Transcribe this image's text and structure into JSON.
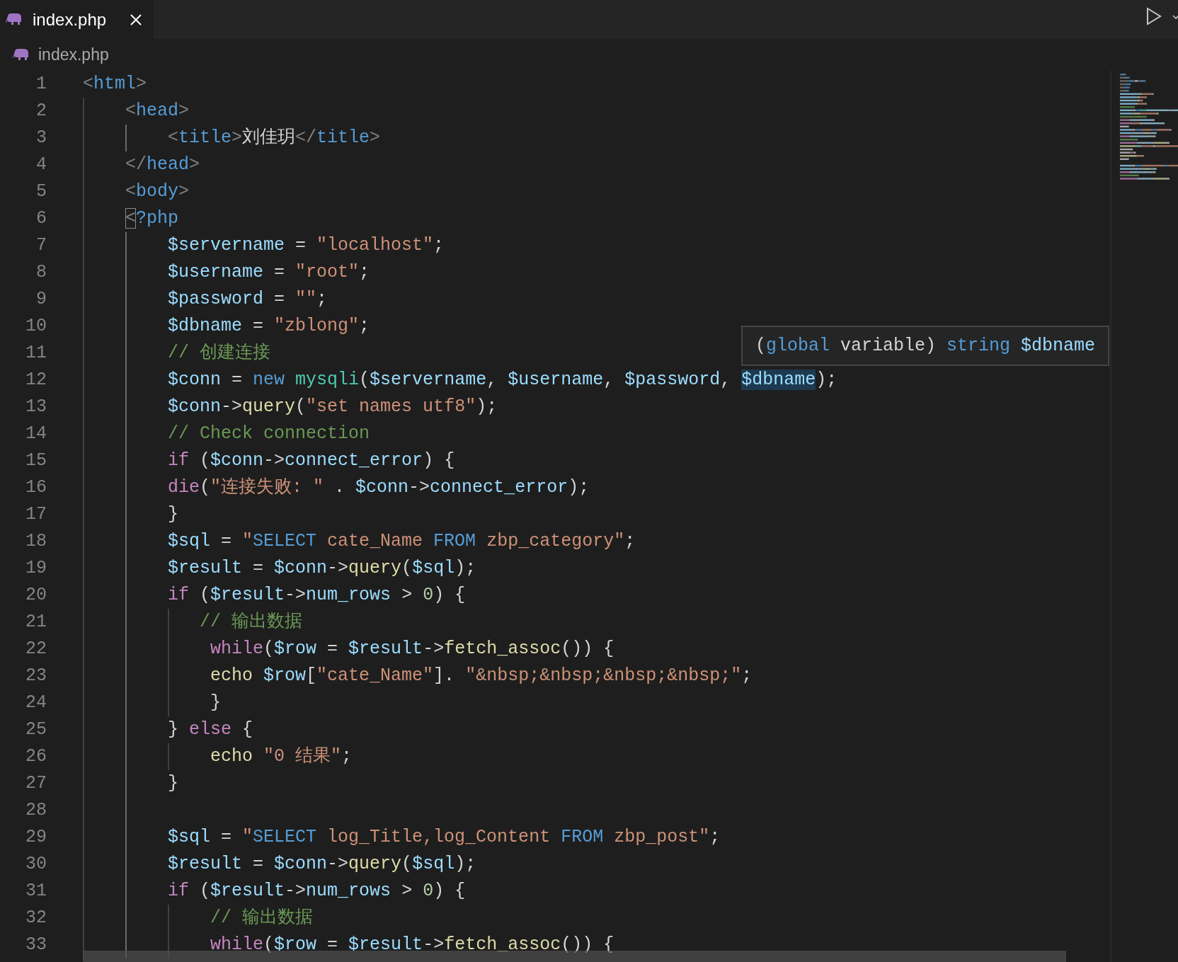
{
  "tabs": [
    {
      "label": "index.php",
      "selected": true
    }
  ],
  "breadcrumb": {
    "label": "index.php"
  },
  "lines": [
    {
      "number": "1",
      "tokens": [
        {
          "text": "<",
          "kind": "bracket"
        },
        {
          "text": "html",
          "kind": "tag"
        },
        {
          "text": ">",
          "kind": "bracket"
        }
      ]
    },
    {
      "number": "2",
      "tokens": [
        {
          "text": "    <",
          "kind": "bracket"
        },
        {
          "text": "head",
          "kind": "tag"
        },
        {
          "text": ">",
          "kind": "bracket"
        }
      ]
    },
    {
      "number": "3",
      "tokens": [
        {
          "text": "        <",
          "kind": "bracket"
        },
        {
          "text": "title",
          "kind": "tag"
        },
        {
          "text": ">",
          "kind": "bracket"
        },
        {
          "text": "刘佳玥",
          "kind": "plain"
        },
        {
          "text": "</",
          "kind": "bracket"
        },
        {
          "text": "title",
          "kind": "tag"
        },
        {
          "text": ">",
          "kind": "bracket"
        }
      ]
    },
    {
      "number": "4",
      "tokens": [
        {
          "text": "    </",
          "kind": "bracket"
        },
        {
          "text": "head",
          "kind": "tag"
        },
        {
          "text": ">",
          "kind": "bracket"
        }
      ]
    },
    {
      "number": "5",
      "tokens": [
        {
          "text": "    <",
          "kind": "bracket"
        },
        {
          "text": "body",
          "kind": "tag"
        },
        {
          "text": ">",
          "kind": "bracket"
        }
      ]
    },
    {
      "number": "6",
      "tokens": [
        {
          "text": "    <",
          "kind": "bracket",
          "matched": true
        },
        {
          "text": "?php",
          "kind": "tag"
        }
      ]
    },
    {
      "number": "7",
      "tokens": [
        {
          "text": "        $servername",
          "kind": "variable"
        },
        {
          "text": " = ",
          "kind": "plain"
        },
        {
          "text": "\"localhost\"",
          "kind": "string"
        },
        {
          "text": ";",
          "kind": "plain"
        }
      ]
    },
    {
      "number": "8",
      "tokens": [
        {
          "text": "        $username",
          "kind": "variable"
        },
        {
          "text": " = ",
          "kind": "plain"
        },
        {
          "text": "\"root\"",
          "kind": "string"
        },
        {
          "text": ";",
          "kind": "plain"
        }
      ]
    },
    {
      "number": "9",
      "tokens": [
        {
          "text": "        $password",
          "kind": "variable"
        },
        {
          "text": " = ",
          "kind": "plain"
        },
        {
          "text": "\"\"",
          "kind": "string"
        },
        {
          "text": ";",
          "kind": "plain"
        }
      ]
    },
    {
      "number": "10",
      "tokens": [
        {
          "text": "        $dbname",
          "kind": "variable"
        },
        {
          "text": " = ",
          "kind": "plain"
        },
        {
          "text": "\"zblong\"",
          "kind": "string"
        },
        {
          "text": ";",
          "kind": "plain"
        }
      ]
    },
    {
      "number": "11",
      "tokens": [
        {
          "text": "        // 创建连接",
          "kind": "comment"
        }
      ]
    },
    {
      "number": "12",
      "tokens": [
        {
          "text": "        $conn",
          "kind": "variable"
        },
        {
          "text": " = ",
          "kind": "plain"
        },
        {
          "text": "new ",
          "kind": "keyword"
        },
        {
          "text": "mysqli",
          "kind": "class"
        },
        {
          "text": "(",
          "kind": "plain"
        },
        {
          "text": "$servername",
          "kind": "variable"
        },
        {
          "text": ", ",
          "kind": "plain"
        },
        {
          "text": "$username",
          "kind": "variable"
        },
        {
          "text": ", ",
          "kind": "plain"
        },
        {
          "text": "$password",
          "kind": "variable"
        },
        {
          "text": ", ",
          "kind": "plain"
        },
        {
          "text": "$dbname",
          "kind": "variable",
          "highlighted": true
        },
        {
          "text": ");",
          "kind": "plain"
        }
      ]
    },
    {
      "number": "13",
      "tokens": [
        {
          "text": "        $conn",
          "kind": "variable"
        },
        {
          "text": "->",
          "kind": "plain"
        },
        {
          "text": "query",
          "kind": "function"
        },
        {
          "text": "(",
          "kind": "plain"
        },
        {
          "text": "\"set names utf8\"",
          "kind": "string"
        },
        {
          "text": ");",
          "kind": "plain"
        }
      ]
    },
    {
      "number": "14",
      "tokens": [
        {
          "text": "        // Check connection",
          "kind": "comment"
        }
      ]
    },
    {
      "number": "15",
      "tokens": [
        {
          "text": "        if",
          "kind": "control"
        },
        {
          "text": " (",
          "kind": "plain"
        },
        {
          "text": "$conn",
          "kind": "variable"
        },
        {
          "text": "->",
          "kind": "plain"
        },
        {
          "text": "connect_error",
          "kind": "variable"
        },
        {
          "text": ") {",
          "kind": "plain"
        }
      ]
    },
    {
      "number": "16",
      "tokens": [
        {
          "text": "        die",
          "kind": "control"
        },
        {
          "text": "(",
          "kind": "plain"
        },
        {
          "text": "\"连接失败: \"",
          "kind": "string"
        },
        {
          "text": " . ",
          "kind": "plain"
        },
        {
          "text": "$conn",
          "kind": "variable"
        },
        {
          "text": "->",
          "kind": "plain"
        },
        {
          "text": "connect_error",
          "kind": "variable"
        },
        {
          "text": ");",
          "kind": "plain"
        }
      ]
    },
    {
      "number": "17",
      "tokens": [
        {
          "text": "        }",
          "kind": "plain"
        }
      ]
    },
    {
      "number": "18",
      "tokens": [
        {
          "text": "        $sql",
          "kind": "variable"
        },
        {
          "text": " = ",
          "kind": "plain"
        },
        {
          "text": "\"",
          "kind": "string"
        },
        {
          "text": "SELECT",
          "kind": "keyword"
        },
        {
          "text": " cate_Name ",
          "kind": "string"
        },
        {
          "text": "FROM",
          "kind": "keyword"
        },
        {
          "text": " zbp_category\"",
          "kind": "string"
        },
        {
          "text": ";",
          "kind": "plain"
        }
      ]
    },
    {
      "number": "19",
      "tokens": [
        {
          "text": "        $result",
          "kind": "variable"
        },
        {
          "text": " = ",
          "kind": "plain"
        },
        {
          "text": "$conn",
          "kind": "variable"
        },
        {
          "text": "->",
          "kind": "plain"
        },
        {
          "text": "query",
          "kind": "function"
        },
        {
          "text": "(",
          "kind": "plain"
        },
        {
          "text": "$sql",
          "kind": "variable"
        },
        {
          "text": ");",
          "kind": "plain"
        }
      ]
    },
    {
      "number": "20",
      "tokens": [
        {
          "text": "        if",
          "kind": "control"
        },
        {
          "text": " (",
          "kind": "plain"
        },
        {
          "text": "$result",
          "kind": "variable"
        },
        {
          "text": "->",
          "kind": "plain"
        },
        {
          "text": "num_rows",
          "kind": "variable"
        },
        {
          "text": " > ",
          "kind": "plain"
        },
        {
          "text": "0",
          "kind": "number"
        },
        {
          "text": ") {",
          "kind": "plain"
        }
      ]
    },
    {
      "number": "21",
      "tokens": [
        {
          "text": "           // 输出数据",
          "kind": "comment"
        }
      ]
    },
    {
      "number": "22",
      "tokens": [
        {
          "text": "            while",
          "kind": "control"
        },
        {
          "text": "(",
          "kind": "plain"
        },
        {
          "text": "$row",
          "kind": "variable"
        },
        {
          "text": " = ",
          "kind": "plain"
        },
        {
          "text": "$result",
          "kind": "variable"
        },
        {
          "text": "->",
          "kind": "plain"
        },
        {
          "text": "fetch_assoc",
          "kind": "function"
        },
        {
          "text": "()) {",
          "kind": "plain"
        }
      ]
    },
    {
      "number": "23",
      "tokens": [
        {
          "text": "            echo ",
          "kind": "function"
        },
        {
          "text": "$row",
          "kind": "variable"
        },
        {
          "text": "[",
          "kind": "plain"
        },
        {
          "text": "\"cate_Name\"",
          "kind": "string"
        },
        {
          "text": "]. ",
          "kind": "plain"
        },
        {
          "text": "\"&nbsp;&nbsp;&nbsp;&nbsp;\"",
          "kind": "string"
        },
        {
          "text": ";",
          "kind": "plain"
        }
      ]
    },
    {
      "number": "24",
      "tokens": [
        {
          "text": "            }",
          "kind": "plain"
        }
      ]
    },
    {
      "number": "25",
      "tokens": [
        {
          "text": "        } ",
          "kind": "plain"
        },
        {
          "text": "else",
          "kind": "control"
        },
        {
          "text": " {",
          "kind": "plain"
        }
      ]
    },
    {
      "number": "26",
      "tokens": [
        {
          "text": "            echo ",
          "kind": "function"
        },
        {
          "text": "\"0 结果\"",
          "kind": "string"
        },
        {
          "text": ";",
          "kind": "plain"
        }
      ]
    },
    {
      "number": "27",
      "tokens": [
        {
          "text": "        }",
          "kind": "plain"
        }
      ]
    },
    {
      "number": "28"
    },
    {
      "number": "29",
      "tokens": [
        {
          "text": "        $sql",
          "kind": "variable"
        },
        {
          "text": " = ",
          "kind": "plain"
        },
        {
          "text": "\"",
          "kind": "string"
        },
        {
          "text": "SELECT",
          "kind": "keyword"
        },
        {
          "text": " log_Title,log_Content ",
          "kind": "string"
        },
        {
          "text": "FROM",
          "kind": "keyword"
        },
        {
          "text": " zbp_post\"",
          "kind": "string"
        },
        {
          "text": ";",
          "kind": "plain"
        }
      ]
    },
    {
      "number": "30",
      "tokens": [
        {
          "text": "        $result",
          "kind": "variable"
        },
        {
          "text": " = ",
          "kind": "plain"
        },
        {
          "text": "$conn",
          "kind": "variable"
        },
        {
          "text": "->",
          "kind": "plain"
        },
        {
          "text": "query",
          "kind": "function"
        },
        {
          "text": "(",
          "kind": "plain"
        },
        {
          "text": "$sql",
          "kind": "variable"
        },
        {
          "text": ");",
          "kind": "plain"
        }
      ]
    },
    {
      "number": "31",
      "tokens": [
        {
          "text": "        if",
          "kind": "control"
        },
        {
          "text": " (",
          "kind": "plain"
        },
        {
          "text": "$result",
          "kind": "variable"
        },
        {
          "text": "->",
          "kind": "plain"
        },
        {
          "text": "num_rows",
          "kind": "variable"
        },
        {
          "text": " > ",
          "kind": "plain"
        },
        {
          "text": "0",
          "kind": "number"
        },
        {
          "text": ") {",
          "kind": "plain"
        }
      ]
    },
    {
      "number": "32",
      "tokens": [
        {
          "text": "            // 输出数据",
          "kind": "comment"
        }
      ]
    },
    {
      "number": "33",
      "tokens": [
        {
          "text": "            while",
          "kind": "control"
        },
        {
          "text": "(",
          "kind": "plain"
        },
        {
          "text": "$row",
          "kind": "variable"
        },
        {
          "text": " = ",
          "kind": "plain"
        },
        {
          "text": "$result",
          "kind": "variable"
        },
        {
          "text": "->",
          "kind": "plain"
        },
        {
          "text": "fetch_assoc",
          "kind": "function"
        },
        {
          "text": "()) {",
          "kind": "plain"
        }
      ]
    }
  ],
  "tooltip": {
    "tokens": [
      {
        "text": "(",
        "kind": "plain"
      },
      {
        "text": "global",
        "kind": "keyword"
      },
      {
        "text": " variable) ",
        "kind": "plain"
      },
      {
        "text": "string ",
        "kind": "keyword"
      },
      {
        "text": "$dbname",
        "kind": "variable"
      }
    ]
  }
}
